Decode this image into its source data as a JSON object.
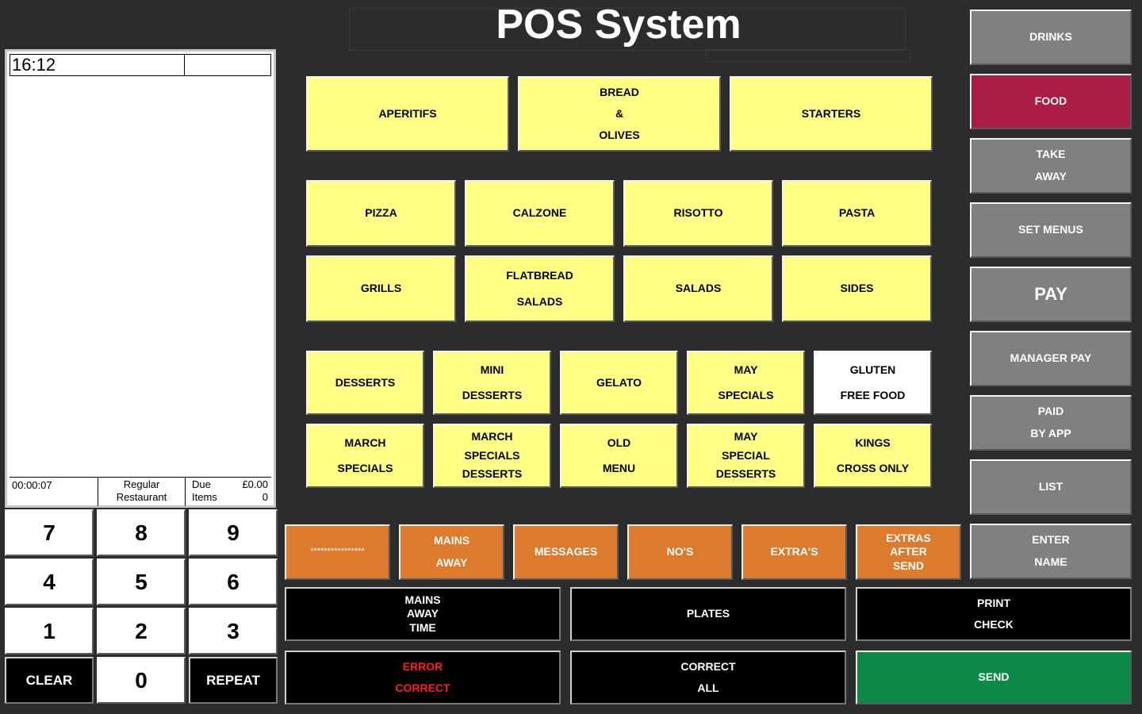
{
  "app": {
    "title": "POS System"
  },
  "receipt": {
    "time": "16:12",
    "elapsed": "00:00:07",
    "mode_line1": "Regular",
    "mode_line2": "Restaurant",
    "due_label": "Due",
    "due_value": "£0.00",
    "items_label": "Items",
    "items_value": "0"
  },
  "keypad": {
    "k7": "7",
    "k8": "8",
    "k9": "9",
    "k4": "4",
    "k5": "5",
    "k6": "6",
    "k1": "1",
    "k2": "2",
    "k3": "3",
    "clear": "CLEAR",
    "k0": "0",
    "repeat": "REPEAT"
  },
  "categories": {
    "aperitifs": "APERITIFS",
    "bread_1": "BREAD",
    "bread_2": "&",
    "bread_3": "OLIVES",
    "starters": "STARTERS",
    "pizza": "PIZZA",
    "calzone": "CALZONE",
    "risotto": "RISOTTO",
    "pasta": "PASTA",
    "grills": "GRILLS",
    "flatbread_1": "FLATBREAD",
    "flatbread_2": "SALADS",
    "salads": "SALADS",
    "sides": "SIDES",
    "desserts": "DESSERTS",
    "mini_1": "MINI",
    "mini_2": "DESSERTS",
    "gelato": "GELATO",
    "may_1": "MAY",
    "may_2": "SPECIALS",
    "gluten_1": "GLUTEN",
    "gluten_2": "FREE FOOD",
    "march_1": "MARCH",
    "march_2": "SPECIALS",
    "marchd_1": "MARCH",
    "marchd_2": "SPECIALS",
    "marchd_3": "DESSERTS",
    "old_1": "OLD",
    "old_2": "MENU",
    "mayd_1": "MAY",
    "mayd_2": "SPECIAL",
    "mayd_3": "DESSERTS",
    "kings_1": "KINGS",
    "kings_2": "CROSS ONLY"
  },
  "modifiers": {
    "stars": "****************",
    "mains_away_1": "MAINS",
    "mains_away_2": "AWAY",
    "messages": "MESSAGES",
    "nos": "NO'S",
    "extras": "EXTRA'S",
    "eas_1": "EXTRAS",
    "eas_2": "AFTER",
    "eas_3": "SEND"
  },
  "actions": {
    "mat_1": "MAINS",
    "mat_2": "AWAY",
    "mat_3": "TIME",
    "plates": "PLATES",
    "print_1": "PRINT",
    "print_2": "CHECK",
    "error_1": "ERROR",
    "error_2": "CORRECT",
    "correct_1": "CORRECT",
    "correct_2": "ALL",
    "send": "SEND"
  },
  "sidebar": {
    "drinks": "DRINKS",
    "food": "FOOD",
    "take_1": "TAKE",
    "take_2": "AWAY",
    "set_menus": "SET MENUS",
    "pay": "PAY",
    "manager_pay": "MANAGER PAY",
    "paid_1": "PAID",
    "paid_2": "BY APP",
    "list": "LIST",
    "enter_1": "ENTER",
    "enter_2": "NAME"
  },
  "colors": {
    "background": "#2b2c2b",
    "category": "#ffff85",
    "selected": "#ad1c43",
    "modifier": "#dc7a2e",
    "send": "#0b8a46",
    "error_text": "#ff1e1e"
  }
}
